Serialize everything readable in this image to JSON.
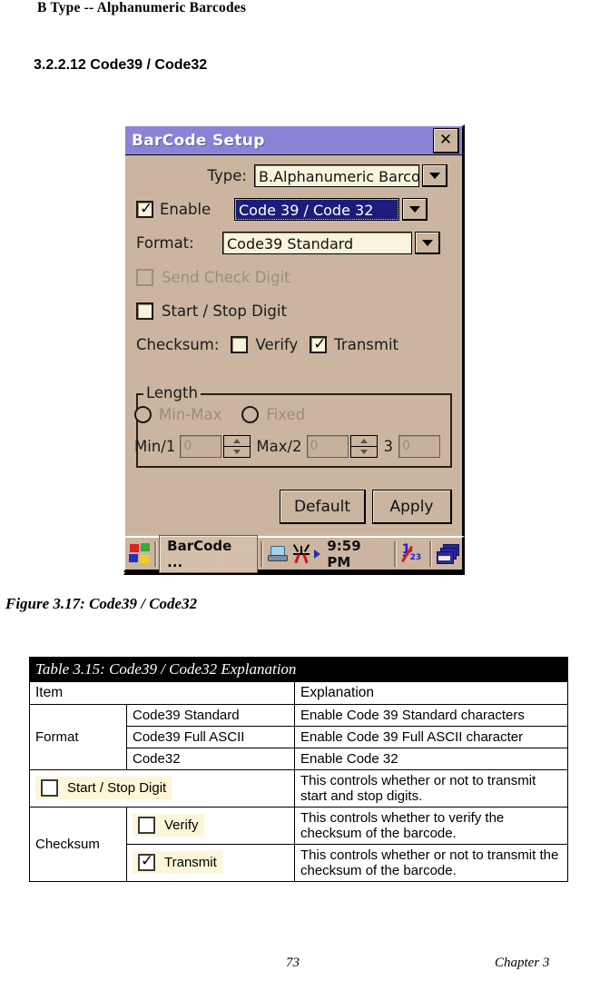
{
  "document": {
    "running_head": "B Type -- Alphanumeric Barcodes",
    "section_title": "3.2.2.12 Code39 / Code32",
    "figure_caption": "Figure 3.17:  Code39 / Code32",
    "footer_page": "73",
    "footer_chapter": "Chapter 3"
  },
  "dialog": {
    "title": "BarCode Setup",
    "close_label": "✕",
    "titlebar_color": "#8a84d6",
    "face_color": "#cbb5a0",
    "field_color": "#f8f4dc",
    "selection_color": "#1c1c7a",
    "type": {
      "label": "Type:",
      "value": "B.Alphanumeric Barcodes"
    },
    "enable": {
      "label": "Enable",
      "checked": true,
      "value": "Code 39 / Code 32"
    },
    "format": {
      "label": "Format:",
      "value": "Code39 Standard"
    },
    "send_check_digit": {
      "label": "Send Check Digit",
      "checked": false,
      "disabled": true
    },
    "start_stop_digit": {
      "label": "Start / Stop Digit",
      "checked": false
    },
    "checksum": {
      "label": "Checksum:",
      "verify_label": "Verify",
      "verify_checked": false,
      "transmit_label": "Transmit",
      "transmit_checked": true
    },
    "length": {
      "legend": "Length",
      "minmax_label": "Min-Max",
      "fixed_label": "Fixed",
      "min_label": "Min/1",
      "min_value": "0",
      "max_label": "Max/2",
      "max_value": "0",
      "third_label": "3",
      "third_value": "0"
    },
    "buttons": {
      "default": "Default",
      "apply": "Apply"
    }
  },
  "taskbar": {
    "task_label": "BarCode ...",
    "clock": "9:59 PM"
  },
  "table": {
    "caption": "Table 3.15: Code39 / Code32 Explanation",
    "headers": [
      "Item",
      "Explanation"
    ],
    "format_group_label": "Format",
    "format_rows": [
      {
        "item": "Code39 Standard",
        "explanation": "Enable Code 39 Standard characters"
      },
      {
        "item": "Code39 Full ASCII",
        "explanation": "Enable Code 39 Full ASCII character"
      },
      {
        "item": "Code32",
        "explanation": "Enable Code 32"
      }
    ],
    "start_stop_row": {
      "item": "Start / Stop Digit",
      "checked": false,
      "explanation": "This controls whether or not to transmit start and stop digits."
    },
    "checksum_group_label": "Checksum",
    "checksum_rows": [
      {
        "item": "Verify",
        "checked": false,
        "explanation": "This controls whether to verify the checksum of the barcode."
      },
      {
        "item": "Transmit",
        "checked": true,
        "explanation": "This controls whether or not to transmit the checksum of the barcode."
      }
    ]
  }
}
